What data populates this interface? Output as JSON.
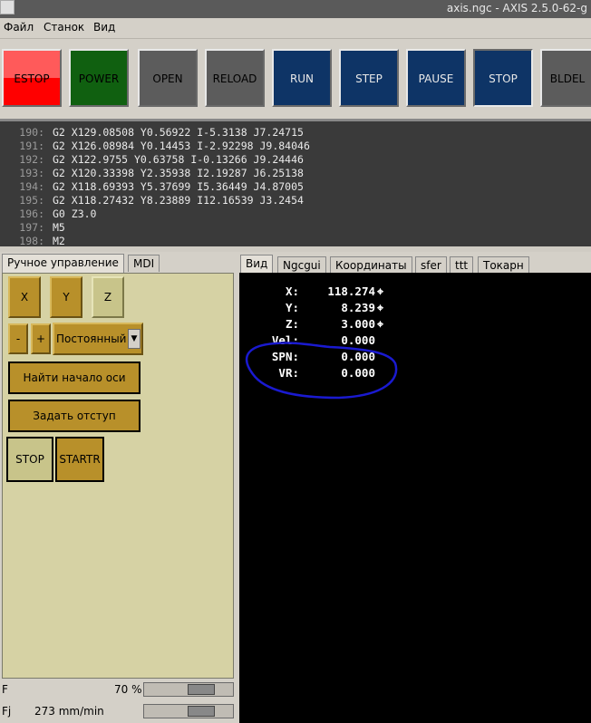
{
  "window": {
    "title": "axis.ngc - AXIS 2.5.0-62-g"
  },
  "menu": [
    "Файл",
    "Станок",
    "Вид"
  ],
  "toolbar": [
    {
      "label": "ESTOP",
      "bg": "#ff4040"
    },
    {
      "label": "POWER",
      "bg": "#106010"
    },
    {
      "label": "OPEN",
      "bg": "#5c5c5c"
    },
    {
      "label": "RELOAD",
      "bg": "#5c5c5c"
    },
    {
      "label": "RUN",
      "bg": "#0e3466"
    },
    {
      "label": "STEP",
      "bg": "#0e3466"
    },
    {
      "label": "PAUSE",
      "bg": "#0e3466"
    },
    {
      "label": "STOP",
      "bg": "#0e3466"
    },
    {
      "label": "BLDEL",
      "bg": "#5c5c5c"
    }
  ],
  "gcode": [
    {
      "n": "190:",
      "code": "G2 X129.08508 Y0.56922 I-5.3138 J7.24715"
    },
    {
      "n": "191:",
      "code": "G2 X126.08984 Y0.14453 I-2.92298 J9.84046"
    },
    {
      "n": "192:",
      "code": "G2 X122.9755 Y0.63758 I-0.13266 J9.24446"
    },
    {
      "n": "193:",
      "code": "G2 X120.33398 Y2.35938 I2.19287 J6.25138"
    },
    {
      "n": "194:",
      "code": "G2 X118.69393 Y5.37699 I5.36449 J4.87005"
    },
    {
      "n": "195:",
      "code": "G2 X118.27432 Y8.23889 I12.16539 J3.2454"
    },
    {
      "n": "196:",
      "code": "G0 Z3.0"
    },
    {
      "n": "197:",
      "code": "M5"
    },
    {
      "n": "198:",
      "code": "M2"
    }
  ],
  "left_tabs": [
    "Ручное управление",
    "MDI"
  ],
  "manual": {
    "axes": [
      "X",
      "Y",
      "Z"
    ],
    "minus": "-",
    "plus": "+",
    "jog_mode": "Постоянный",
    "home_label": "Найти начало оси",
    "offset_label": "Задать отступ",
    "stop_label": "STOP",
    "start_label": "STARTR"
  },
  "right_tabs": [
    "Вид",
    "Ngcgui",
    "Координаты",
    "sfer",
    "ttt",
    "Токарн"
  ],
  "dro": [
    {
      "label": "X:",
      "value": "118.274"
    },
    {
      "label": "Y:",
      "value": "8.239"
    },
    {
      "label": "Z:",
      "value": "3.000"
    },
    {
      "label": "Vel:",
      "value": "0.000"
    },
    {
      "label": "SPN:",
      "value": "0.000"
    },
    {
      "label": "VR:",
      "value": "0.000"
    }
  ],
  "feed": {
    "label": "F",
    "value": "70 %",
    "fraction": 0.7
  },
  "jog": {
    "label": "Fj",
    "value": "273 mm/min",
    "fraction": 0.7
  },
  "colors": {
    "annotation": "#1a1ad0"
  }
}
